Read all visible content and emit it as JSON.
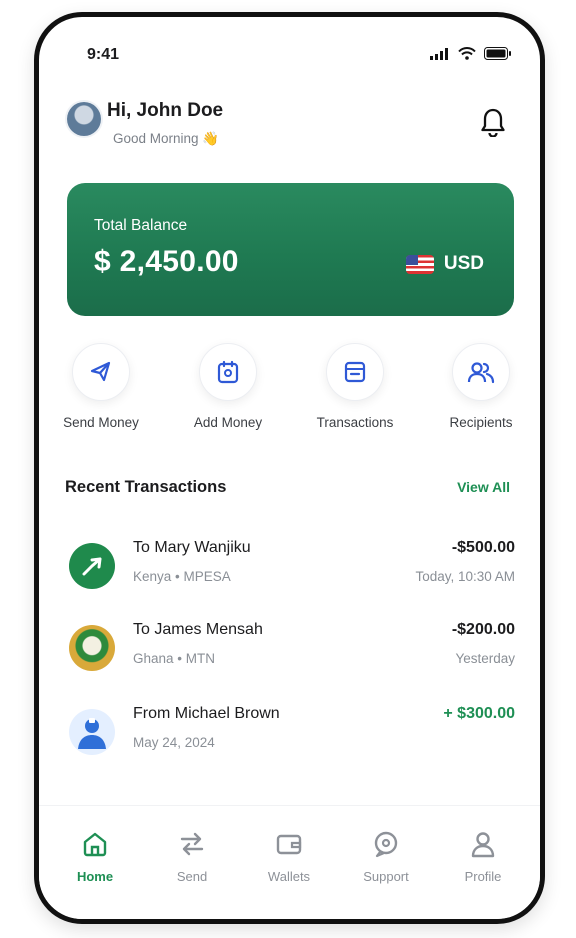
{
  "status_bar": {
    "time": "9:41"
  },
  "header": {
    "greeting": "Hi, John Doe",
    "subtitle": "Good Morning 👋"
  },
  "balance_card": {
    "label": "Total Balance",
    "amount": "$ 2,450.00",
    "currency": "USD",
    "color": "#1f7a52"
  },
  "quick_actions": [
    {
      "label": "Send Money",
      "icon": "send-money-icon"
    },
    {
      "label": "Add Money",
      "icon": "add-money-icon"
    },
    {
      "label": "Transactions",
      "icon": "transactions-icon"
    },
    {
      "label": "Recipients",
      "icon": "recipients-icon"
    }
  ],
  "recent": {
    "title": "Recent Transactions",
    "view_all": "View All",
    "items": [
      {
        "name": "To Mary Wanjiku",
        "meta": "Kenya • MPESA",
        "amount": "-$500.00",
        "when": "Today, 10:30 AM"
      },
      {
        "name": "To James Mensah",
        "meta": "Ghana • MTN",
        "amount": "-$200.00",
        "when": "Yesterday"
      },
      {
        "name": "From Michael Brown",
        "meta": "May 24, 2024",
        "amount": "+ $300.00",
        "when": ""
      }
    ]
  },
  "bottom_nav": [
    {
      "label": "Home",
      "active": true
    },
    {
      "label": "Send"
    },
    {
      "label": "Wallets"
    },
    {
      "label": "Support"
    },
    {
      "label": "Profile"
    }
  ],
  "colors": {
    "accent": "#1e8f54",
    "action_icon": "#2f59d6"
  }
}
